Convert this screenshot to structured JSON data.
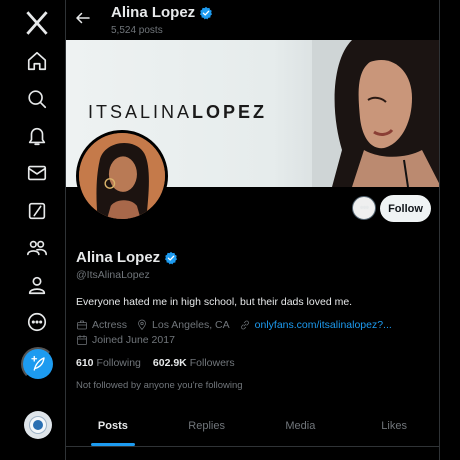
{
  "colors": {
    "accent": "#1d9bf0",
    "background": "#000000",
    "muted": "#71767b",
    "text": "#e7e9ea"
  },
  "nav": {
    "items": [
      {
        "icon": "x-logo-icon"
      },
      {
        "icon": "home-icon"
      },
      {
        "icon": "search-icon"
      },
      {
        "icon": "bell-icon"
      },
      {
        "icon": "mail-icon"
      },
      {
        "icon": "grok-icon"
      },
      {
        "icon": "communities-icon"
      },
      {
        "icon": "profile-icon"
      },
      {
        "icon": "more-circle-icon"
      }
    ],
    "post_button_icon": "feather-plus-icon"
  },
  "header": {
    "back_icon": "arrow-left-icon",
    "title": "Alina Lopez",
    "post_count": "5,524 posts"
  },
  "banner": {
    "text_light": "ITSALINA",
    "text_bold": "LOPEZ"
  },
  "actions": {
    "more_label": "•••",
    "follow_label": "Follow"
  },
  "profile": {
    "name": "Alina Lopez",
    "handle": "@ItsAlinaLopez",
    "bio": "Everyone hated me in high school, but their dads loved me.",
    "category": "Actress",
    "location": "Los Angeles, CA",
    "website": "onlyfans.com/itsalinalopez?...",
    "joined": "Joined June 2017"
  },
  "stats": {
    "following_count": "610",
    "following_label": "Following",
    "followers_count": "602.9K",
    "followers_label": "Followers"
  },
  "followed_by": "Not followed by anyone you're following",
  "tabs": [
    {
      "label": "Posts",
      "active": true
    },
    {
      "label": "Replies",
      "active": false
    },
    {
      "label": "Media",
      "active": false
    },
    {
      "label": "Likes",
      "active": false
    }
  ]
}
